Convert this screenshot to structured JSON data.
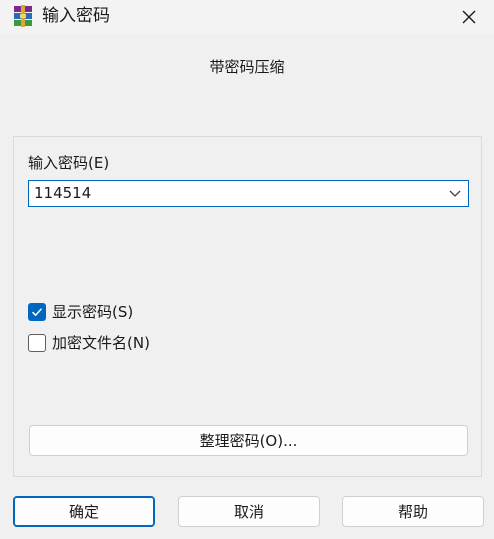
{
  "window": {
    "title": "输入密码",
    "close_icon": "close-icon",
    "app_icon": "winrar-icon"
  },
  "dialog": {
    "subtitle": "带密码压缩",
    "password": {
      "label": "输入密码(E)",
      "value": "114514"
    },
    "show_password": {
      "label": "显示密码(S)",
      "checked": true
    },
    "encrypt_filenames": {
      "label": "加密文件名(N)",
      "checked": false
    },
    "organize_button": "整理密码(O)..."
  },
  "footer": {
    "ok": "确定",
    "cancel": "取消",
    "help": "帮助"
  },
  "colors": {
    "accent": "#0067c0",
    "background": "#f0f0f0"
  }
}
